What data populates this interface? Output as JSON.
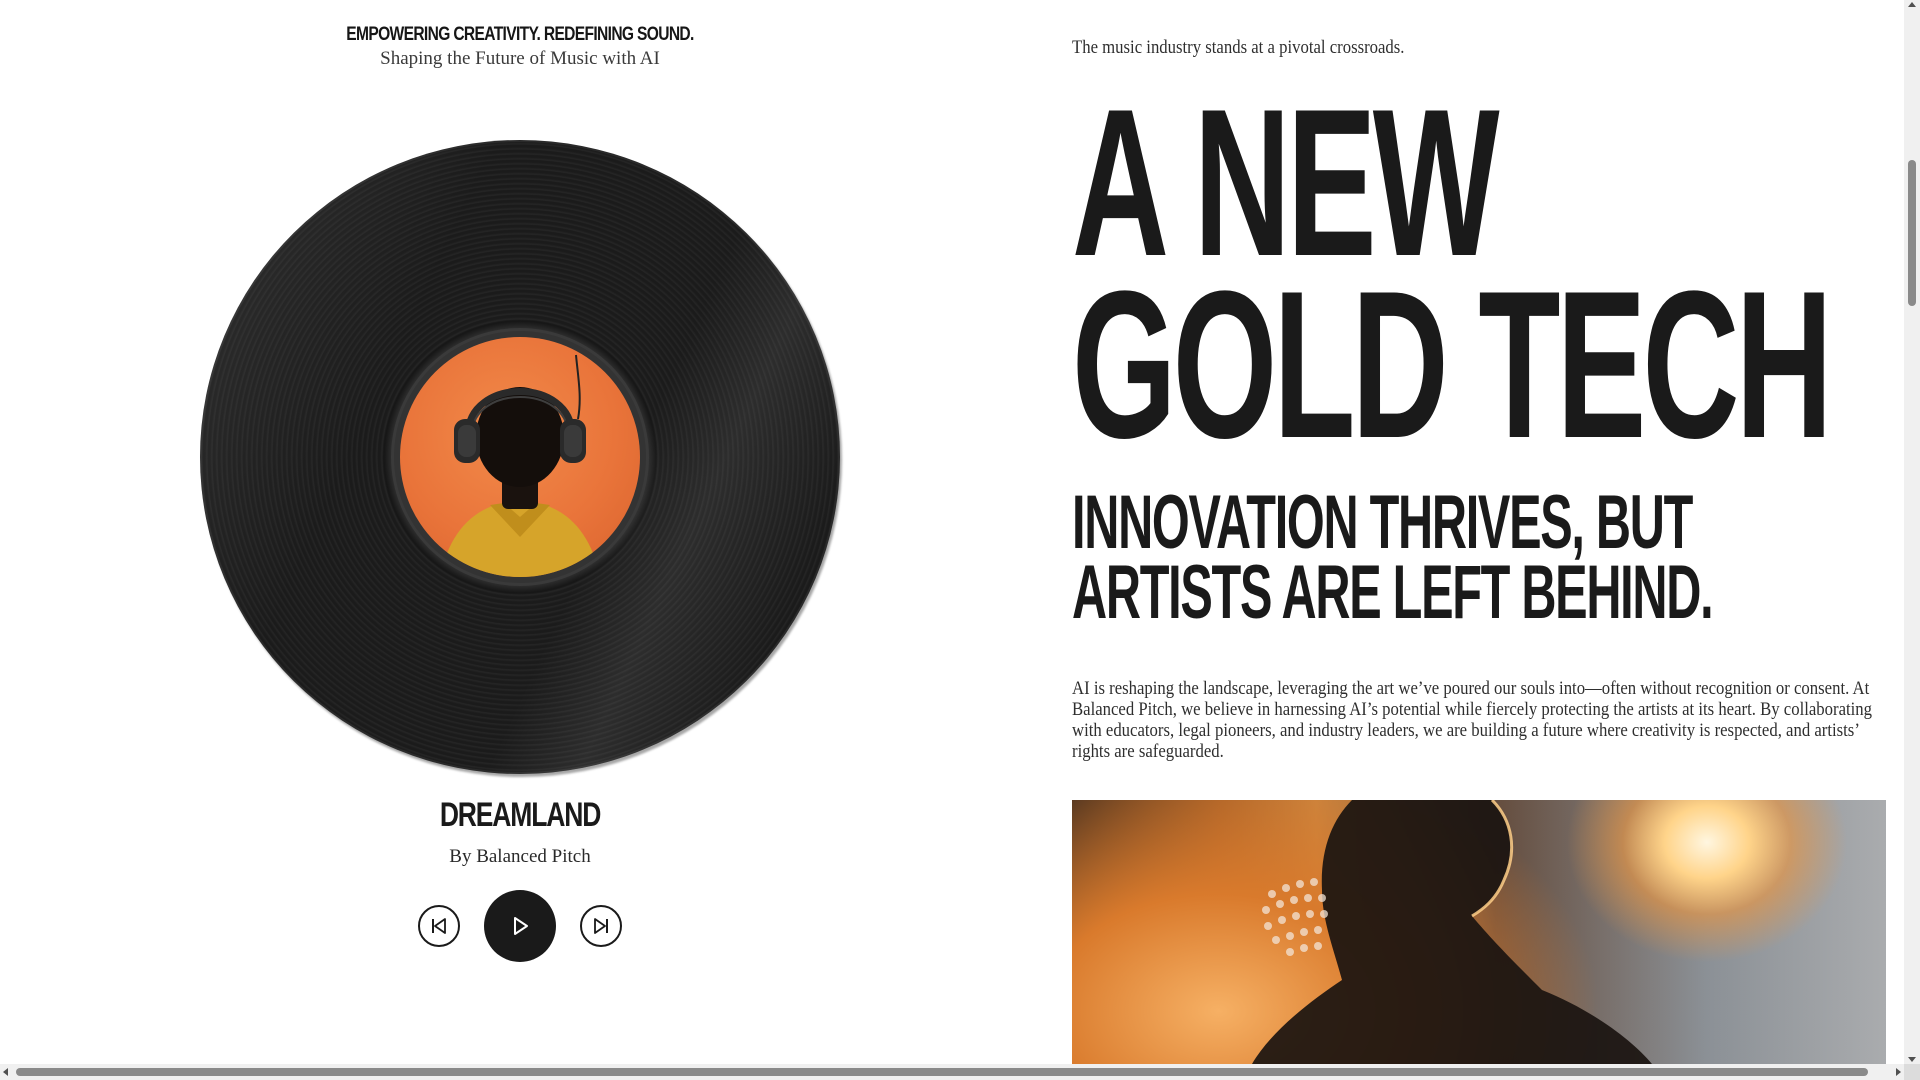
{
  "left": {
    "tagline": "EMPOWERING CREATIVITY. REDEFINING SOUND.",
    "subtagline": "Shaping the Future of Music with AI",
    "player": {
      "song_title": "DREAMLAND",
      "artist": "By Balanced Pitch",
      "controls": {
        "previous_icon": "skip-previous-icon",
        "play_icon": "play-icon",
        "next_icon": "skip-next-icon"
      },
      "label_color": "#ea7a3f"
    }
  },
  "right": {
    "intro": "The music industry stands at a pivotal crossroads.",
    "headline": {
      "line1": "A NEW",
      "line2": "GOLD TECH"
    },
    "subheadline": "INNOVATION THRIVES, BUT ARTISTS ARE LEFT BEHIND.",
    "body": "AI is reshaping the landscape, leveraging the art we’ve poured our souls into—often without recognition or consent. At Balanced Pitch, we believe in harnessing AI’s potential while fiercely protecting the artists at its heart. By collaborating with educators, legal pioneers, and industry leaders, we are building a future where creativity is respected, and artists’ rights are safeguarded."
  },
  "colors": {
    "text": "#1a1a1a",
    "background": "#ffffff",
    "accent_orange": "#ea7a3f"
  }
}
